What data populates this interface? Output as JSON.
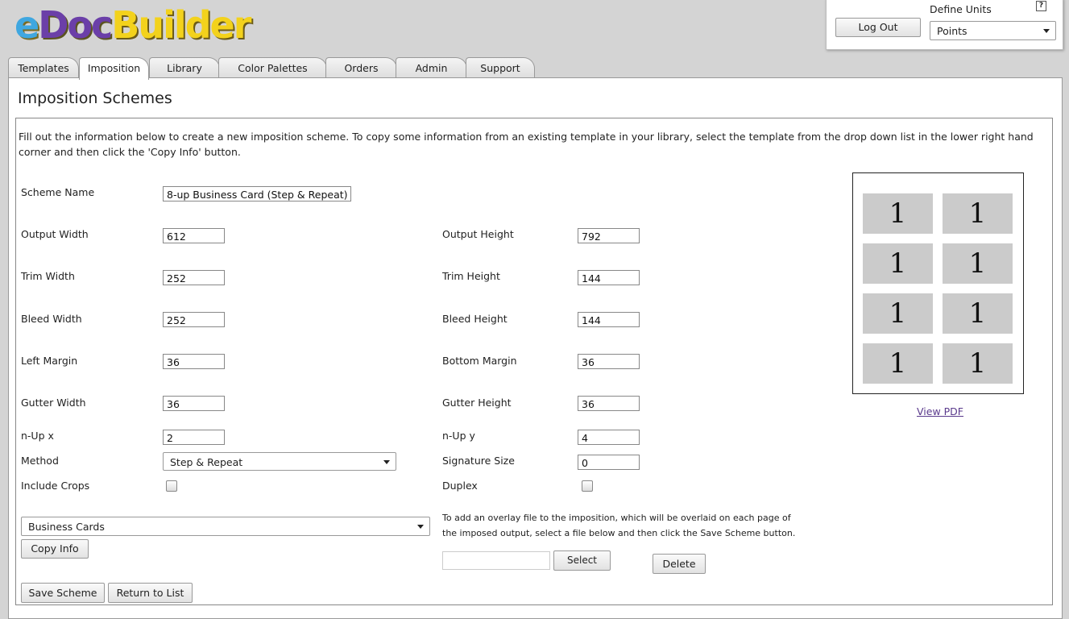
{
  "logo": {
    "e": "e",
    "doc": "Doc",
    "builder": "Builder"
  },
  "header": {
    "logout_label": "Log Out",
    "define_units_label": "Define Units",
    "help_label": "?",
    "units_value": "Points"
  },
  "tabs": [
    {
      "label": "Templates"
    },
    {
      "label": "Imposition"
    },
    {
      "label": "Library"
    },
    {
      "label": "Color Palettes"
    },
    {
      "label": "Orders"
    },
    {
      "label": "Admin"
    },
    {
      "label": "Support"
    }
  ],
  "page": {
    "title": "Imposition Schemes",
    "intro": "Fill out the information below to create a new imposition scheme. To copy some information from an existing template in your library, select the template from the drop down list in the lower right hand corner and then click the 'Copy Info' button."
  },
  "form": {
    "scheme_name_label": "Scheme Name",
    "scheme_name_value": "8-up Business Card (Step & Repeat)",
    "output_width_label": "Output Width",
    "output_width_value": "612",
    "output_height_label": "Output Height",
    "output_height_value": "792",
    "trim_width_label": "Trim Width",
    "trim_width_value": "252",
    "trim_height_label": "Trim Height",
    "trim_height_value": "144",
    "bleed_width_label": "Bleed Width",
    "bleed_width_value": "252",
    "bleed_height_label": "Bleed Height",
    "bleed_height_value": "144",
    "left_margin_label": "Left Margin",
    "left_margin_value": "36",
    "bottom_margin_label": "Bottom Margin",
    "bottom_margin_value": "36",
    "gutter_width_label": "Gutter Width",
    "gutter_width_value": "36",
    "gutter_height_label": "Gutter Height",
    "gutter_height_value": "36",
    "nup_x_label": "n-Up x",
    "nup_x_value": "2",
    "nup_y_label": "n-Up y",
    "nup_y_value": "4",
    "method_label": "Method",
    "method_value": "Step & Repeat",
    "signature_size_label": "Signature Size",
    "signature_size_value": "0",
    "include_crops_label": "Include Crops",
    "include_crops_checked": false,
    "duplex_label": "Duplex",
    "duplex_checked": false
  },
  "copy": {
    "template_value": "Business Cards",
    "copy_info_label": "Copy Info"
  },
  "overlay": {
    "text": "To add an overlay file to the imposition, which will be overlaid on each page of the imposed output, select a file below and then click the Save Scheme button.",
    "file_value": "",
    "select_label": "Select",
    "delete_label": "Delete"
  },
  "actions": {
    "save_label": "Save Scheme",
    "return_label": "Return to List"
  },
  "preview": {
    "cells": [
      "1",
      "1",
      "1",
      "1",
      "1",
      "1",
      "1",
      "1"
    ],
    "view_pdf_label": "View PDF"
  }
}
